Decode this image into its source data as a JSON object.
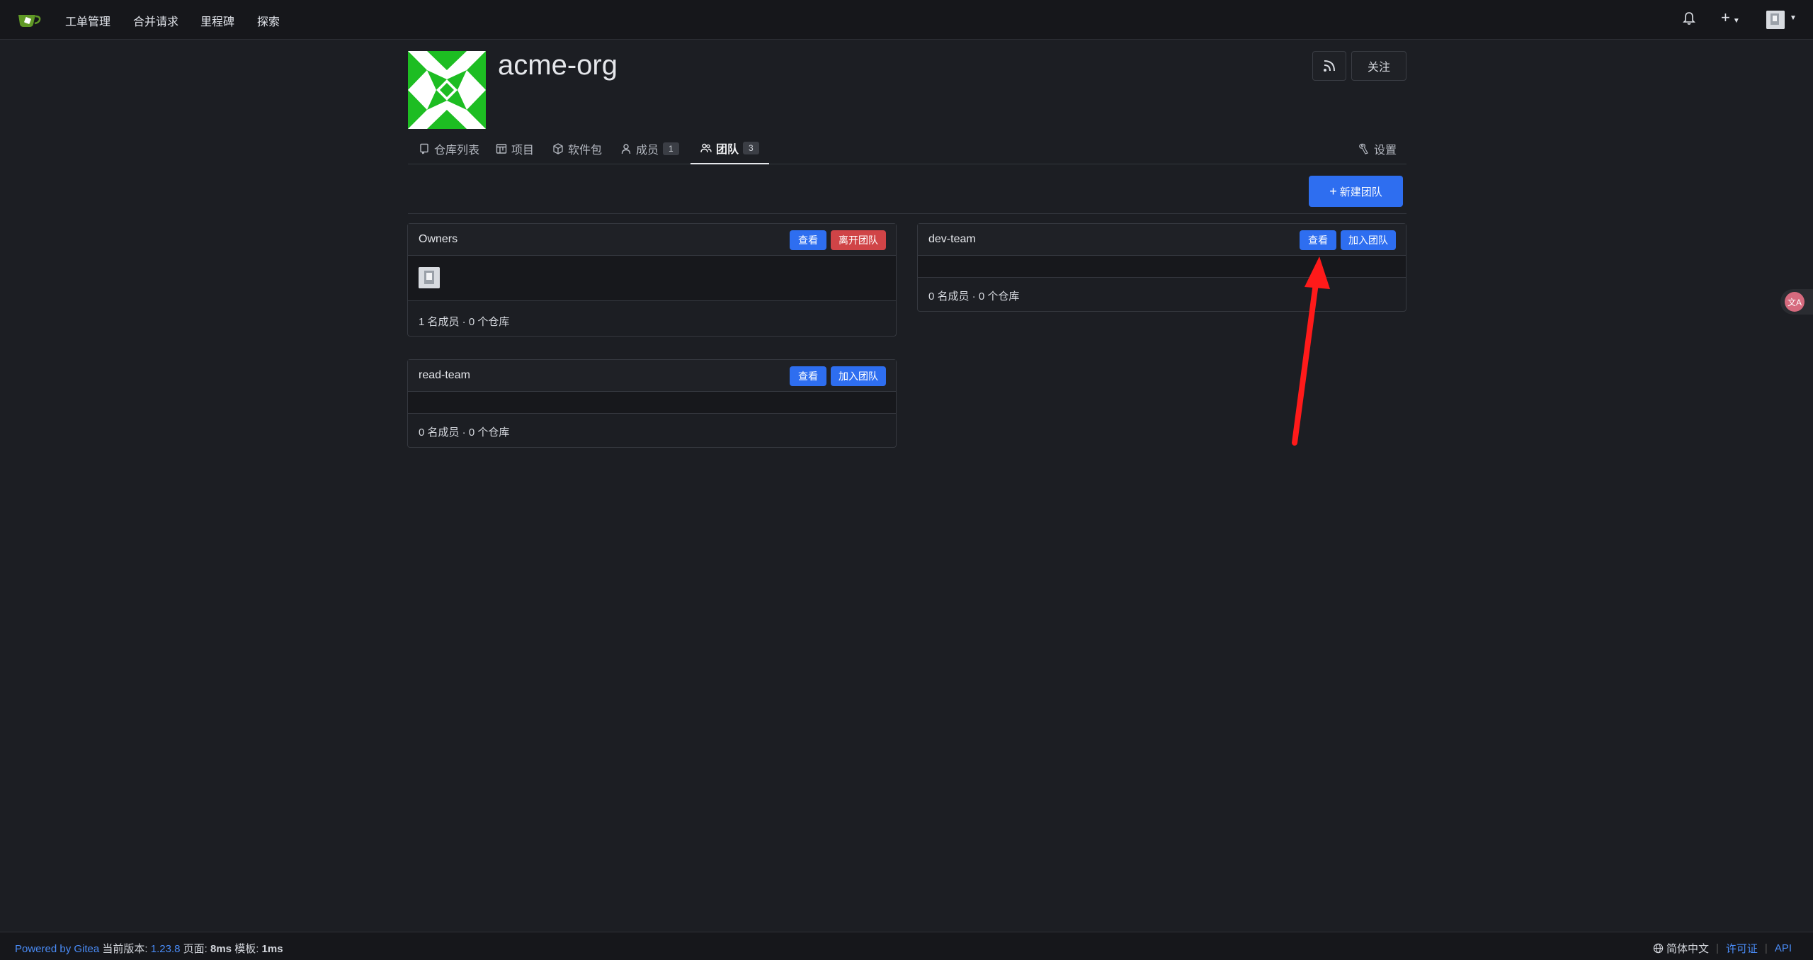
{
  "navbar": {
    "items": [
      "工单管理",
      "合并请求",
      "里程碑",
      "探索"
    ],
    "plus_label": "+"
  },
  "org": {
    "name": "acme-org",
    "follow_label": "关注"
  },
  "tabs": [
    {
      "label": "仓库列表"
    },
    {
      "label": "项目"
    },
    {
      "label": "软件包"
    },
    {
      "label": "成员",
      "count": "1"
    },
    {
      "label": "团队",
      "count": "3",
      "active": true
    }
  ],
  "settings_label": "设置",
  "new_team_label": "新建团队",
  "teams": [
    {
      "name": "Owners",
      "view_label": "查看",
      "action_label": "离开团队",
      "footer": "1 名成员 · 0 个仓库"
    },
    {
      "name": "dev-team",
      "view_label": "查看",
      "action_label": "加入团队",
      "footer": "0 名成员 · 0 个仓库"
    },
    {
      "name": "read-team",
      "view_label": "查看",
      "action_label": "加入团队",
      "footer": "0 名成员 · 0 个仓库"
    }
  ],
  "footer": {
    "powered": "Powered by Gitea",
    "version_label": "当前版本:",
    "version": "1.23.8",
    "page_label": "页面:",
    "page_time": "8ms",
    "template_label": "模板:",
    "template_time": "1ms",
    "language": "简体中文",
    "license": "许可证",
    "api": "API"
  },
  "colors": {
    "primary": "#2e6ef0",
    "danger": "#d04447",
    "annotation_arrow": "#ff1a1a"
  }
}
